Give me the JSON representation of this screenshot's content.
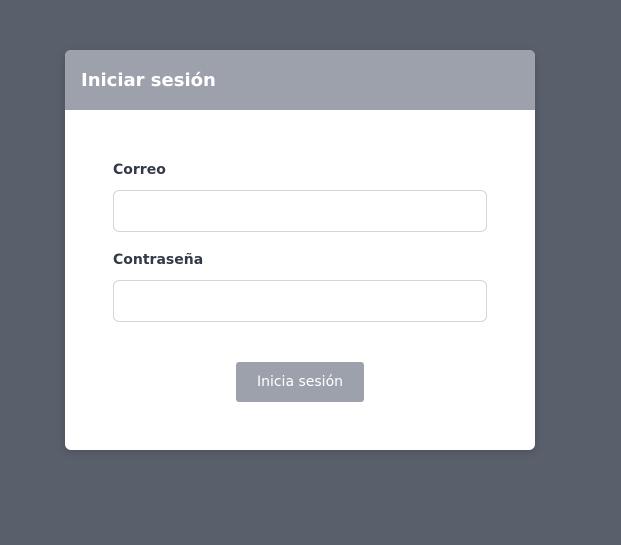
{
  "login": {
    "title": "Iniciar sesión",
    "email_label": "Correo",
    "email_value": "",
    "email_placeholder": "",
    "password_label": "Contraseña",
    "password_value": "",
    "password_placeholder": "",
    "submit_label": "Inicia sesión"
  },
  "colors": {
    "background": "#595f6b",
    "header": "#9ca1ac",
    "button": "#9ca1ac",
    "label_text": "#333a46"
  }
}
